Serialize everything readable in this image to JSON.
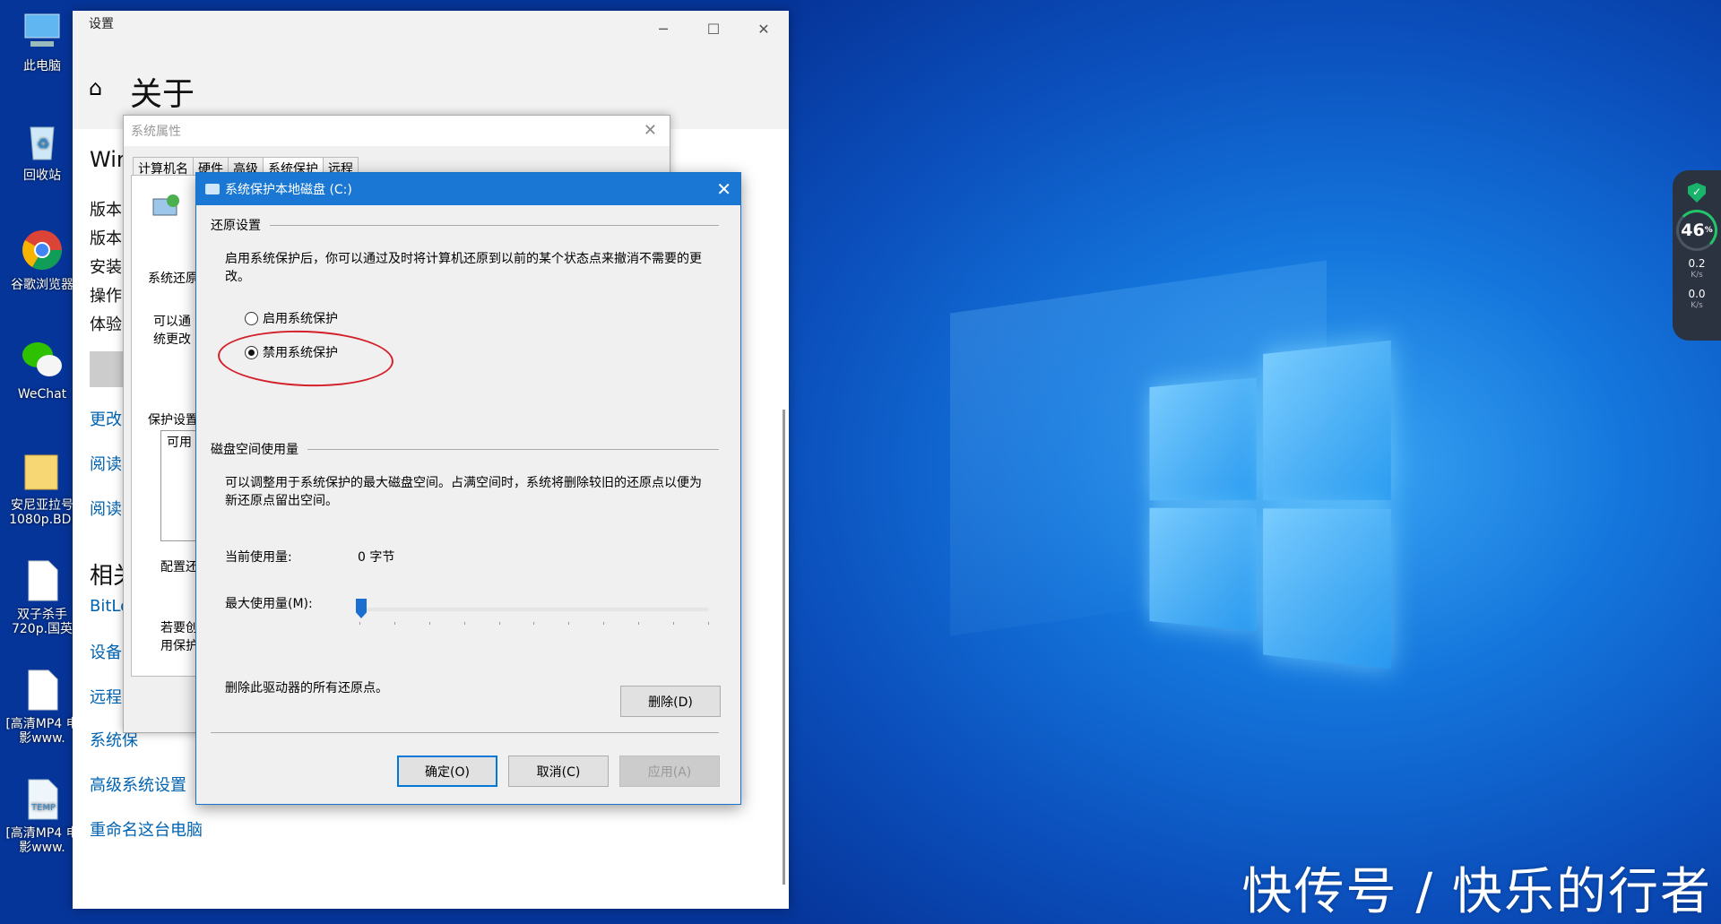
{
  "desktop": {
    "icons": [
      {
        "label": "此电脑",
        "icon": "computer-icon"
      },
      {
        "label": "回收站",
        "icon": "recycle-bin-icon"
      },
      {
        "label": "谷歌浏览器",
        "icon": "chrome-icon"
      },
      {
        "label": "WeChat",
        "icon": "wechat-icon"
      },
      {
        "label": "安尼亚拉号 1080p.BD.",
        "icon": "folder-icon"
      },
      {
        "label": "双子杀手 720p.国英",
        "icon": "file-icon"
      },
      {
        "label": "[高清MP4 电影www.",
        "icon": "file-icon"
      },
      {
        "label": "[高清MP4 电影www.",
        "icon": "temp-file-icon"
      }
    ],
    "watermark": "快传号 / 快乐的行者"
  },
  "widget": {
    "percent": "46",
    "percent_unit": "%",
    "up_speed": "0.2",
    "up_unit": "K/s",
    "down_speed": "0.0",
    "down_unit": "K/s"
  },
  "settings": {
    "title": "设置",
    "page_title": "关于",
    "partial_labels": [
      "Win",
      "版本",
      "版本",
      "安装",
      "操作",
      "体验"
    ],
    "links": [
      "更改",
      "阅读",
      "阅读"
    ],
    "related_heading": "相关",
    "related_links": [
      "BitLo",
      "设备",
      "远程",
      "系统保",
      "高级系统设置",
      "重命名这台电脑"
    ]
  },
  "system_properties": {
    "title": "系统属性",
    "tabs": [
      "计算机名",
      "硬件",
      "高级",
      "系统保护",
      "远程"
    ],
    "partial_texts": [
      "系统还原",
      "可以通",
      "统更改",
      "保护设置",
      "可用",
      "配置还",
      "若要创",
      "用保护"
    ]
  },
  "dialog": {
    "title": "系统保护本地磁盘 (C:)",
    "restore_group": "还原设置",
    "restore_desc": "启用系统保护后，你可以通过及时将计算机还原到以前的某个状态点来撤消不需要的更改。",
    "radio_enable": "启用系统保护",
    "radio_disable": "禁用系统保护",
    "selected": "disable",
    "disk_group": "磁盘空间使用量",
    "disk_desc": "可以调整用于系统保护的最大磁盘空间。占满空间时，系统将删除较旧的还原点以便为新还原点留出空间。",
    "current_usage_label": "当前使用量:",
    "current_usage_value": "0 字节",
    "max_usage_label": "最大使用量(M):",
    "max_usage_fraction": 0,
    "delete_desc": "删除此驱动器的所有还原点。",
    "delete_button": "删除(D)",
    "ok_button": "确定(O)",
    "cancel_button": "取消(C)",
    "apply_button": "应用(A)"
  }
}
